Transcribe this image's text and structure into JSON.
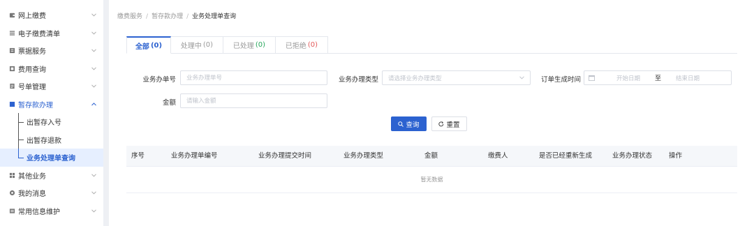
{
  "sidebar": {
    "items": [
      {
        "label": "网上缴费",
        "icon": "wallet-icon"
      },
      {
        "label": "电子缴费清单",
        "icon": "list-icon"
      },
      {
        "label": "票据服务",
        "icon": "receipt-icon"
      },
      {
        "label": "费用查询",
        "icon": "query-icon"
      },
      {
        "label": "号单管理",
        "icon": "document-icon"
      },
      {
        "label": "暂存款办理",
        "icon": "deposit-icon"
      },
      {
        "label": "出暂存入号"
      },
      {
        "label": "出暂存退款"
      },
      {
        "label": "业务处理单查询"
      },
      {
        "label": "其他业务",
        "icon": "grid-icon"
      },
      {
        "label": "我的消息",
        "icon": "message-icon"
      },
      {
        "label": "常用信息维护",
        "icon": "settings-icon"
      }
    ]
  },
  "breadcrumb": {
    "items": [
      "缴费服务",
      "暂存款办理",
      "业务处理单查询"
    ],
    "separator": "/"
  },
  "tabs": [
    {
      "label": "全部",
      "count": "(0)"
    },
    {
      "label": "处理中",
      "count": "(0)"
    },
    {
      "label": "已处理",
      "count": "(0)"
    },
    {
      "label": "已拒绝",
      "count": "(0)"
    }
  ],
  "filters": {
    "order_no": {
      "label": "业务办单号",
      "placeholder": "业务办理单号"
    },
    "biz_type": {
      "label": "业务办理类型",
      "placeholder": "请选择业务办理类型"
    },
    "order_time": {
      "label": "订单生成时间",
      "start_placeholder": "开始日期",
      "separator": "至",
      "end_placeholder": "结束日期"
    },
    "amount": {
      "label": "金额",
      "placeholder": "请输入金额"
    }
  },
  "buttons": {
    "search": "查询",
    "reset": "重置"
  },
  "table": {
    "columns": [
      "序号",
      "业务办理单编号",
      "业务办理提交时间",
      "业务办理类型",
      "金额",
      "缴费人",
      "是否已经重新生成",
      "业务办理状态",
      "操作"
    ],
    "empty_text": "暂无数据"
  },
  "colors": {
    "accent": "#2c62d0",
    "active_bg": "#e6efff",
    "count_green": "#26a65b",
    "count_red": "#e35a5a"
  }
}
